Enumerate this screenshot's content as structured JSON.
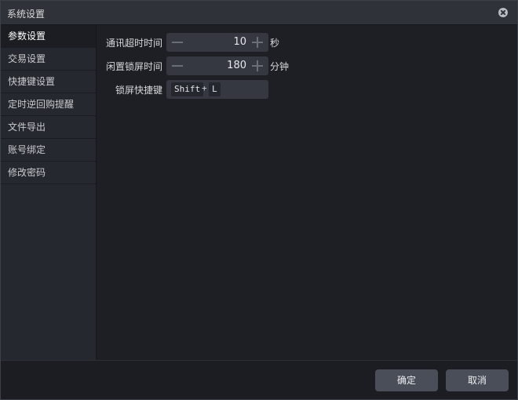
{
  "window": {
    "title": "系统设置"
  },
  "sidebar": {
    "items": [
      {
        "label": "参数设置",
        "active": true
      },
      {
        "label": "交易设置",
        "active": false
      },
      {
        "label": "快捷键设置",
        "active": false
      },
      {
        "label": "定时逆回购提醒",
        "active": false
      },
      {
        "label": "文件导出",
        "active": false
      },
      {
        "label": "账号绑定",
        "active": false
      },
      {
        "label": "修改密码",
        "active": false
      }
    ]
  },
  "settings": {
    "timeout": {
      "label": "通讯超时时间",
      "value": "10",
      "unit": "秒"
    },
    "idle_lock": {
      "label": "闲置锁屏时间",
      "value": "180",
      "unit": "分钟"
    },
    "lock_hotkey": {
      "label": "锁屏快捷键",
      "modifier": "Shift",
      "plus": "+",
      "key": "L"
    }
  },
  "footer": {
    "ok_label": "确定",
    "cancel_label": "取消"
  },
  "colors": {
    "background": "#1d1f24",
    "sidebar": "#25282e",
    "field": "#353840",
    "button": "#4a4e58"
  }
}
